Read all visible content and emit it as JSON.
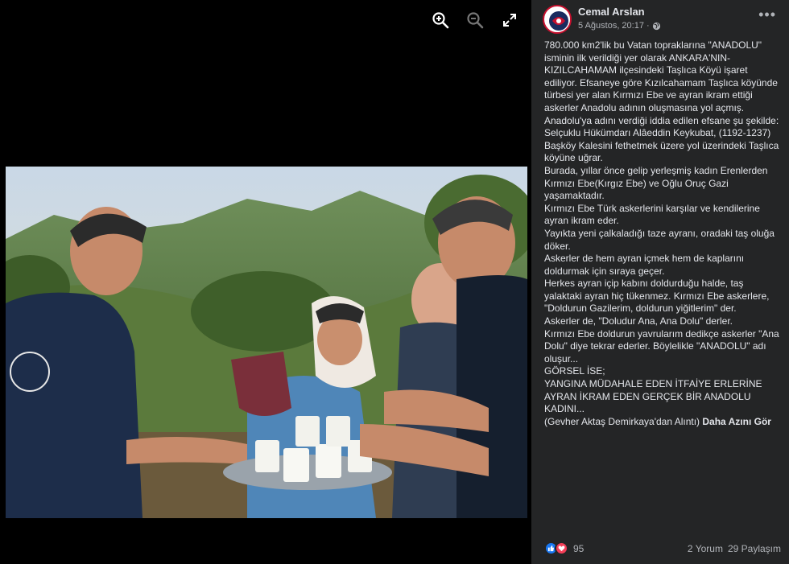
{
  "post": {
    "author": "Cemal Arslan",
    "date": "5 Ağustos, 20:17",
    "separator": "·",
    "paragraphs": [
      "780.000 km2'lik bu Vatan topraklarına \"ANADOLU\" isminin ilk verildiği yer olarak ANKARA'NIN-KIZILCAHAMAM ilçesindeki Taşlıca Köyü işaret ediliyor. Efsaneye göre Kızılcahamam Taşlıca köyünde türbesi yer alan Kırmızı Ebe ve ayran ikram ettiği askerler Anadolu adının oluşmasına yol açmış.",
      "Anadolu'ya adını verdiği iddia edilen efsane şu şekilde:",
      "Selçuklu Hükümdarı Alâeddin Keykubat, (1192-1237) Başköy Kalesini fethetmek üzere yol üzerindeki Taşlıca köyüne uğrar.",
      "Burada, yıllar önce gelip yerleşmiş kadın Erenlerden Kırmızı Ebe(Kırgız Ebe) ve Oğlu Oruç Gazi yaşamaktadır.",
      "Kırmızı Ebe Türk askerlerini karşılar ve kendilerine ayran ikram eder.",
      "Yayıkta yeni çalkaladığı taze ayranı, oradaki taş oluğa döker.",
      "Askerler de hem ayran içmek hem de kaplarını doldurmak için sıraya geçer.",
      "Herkes ayran içip kabını doldurduğu halde, taş yalaktaki ayran hiç tükenmez. Kırmızı Ebe askerlere, \"Doldurun Gazilerim, doldurun yiğitlerim\" der.",
      "Askerler de, \"Doludur Ana, Ana Dolu\" derler.",
      "Kırmızı Ebe doldurun yavrularım dedikçe askerler \"Ana Dolu\" diye tekrar ederler. Böylelikle \"ANADOLU\" adı oluşur...",
      "GÖRSEL İSE;",
      "YANGINA MÜDAHALE EDEN İTFAİYE ERLERİNE AYRAN İKRAM EDEN GERÇEK BİR ANADOLU KADINI..."
    ],
    "last_line": "(Gevher Aktaş Demirkaya'dan Alıntı)",
    "see_more": "Daha Azını Gör"
  },
  "stats": {
    "reaction_count": "95",
    "comments": "2 Yorum",
    "shares": "29 Paylaşım"
  },
  "icons": {
    "zoom_in": "zoom-in-icon",
    "zoom_out": "zoom-out-icon",
    "fullscreen": "fullscreen-icon",
    "globe": "globe-icon",
    "more": "more-options-icon",
    "like": "like-reaction-icon",
    "love": "love-reaction-icon"
  },
  "colors": {
    "panel_bg": "#242526",
    "viewer_bg": "#000000",
    "text_primary": "#e4e6eb",
    "text_secondary": "#b0b3b8",
    "like_blue": "#1877f2",
    "love_red": "#f33e58"
  }
}
